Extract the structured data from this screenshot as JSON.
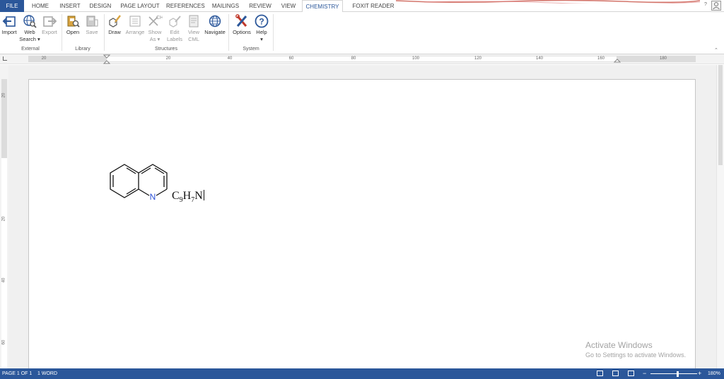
{
  "tabs": [
    {
      "label": "FILE"
    },
    {
      "label": "HOME"
    },
    {
      "label": "INSERT"
    },
    {
      "label": "DESIGN"
    },
    {
      "label": "PAGE LAYOUT"
    },
    {
      "label": "REFERENCES"
    },
    {
      "label": "MAILINGS"
    },
    {
      "label": "REVIEW"
    },
    {
      "label": "VIEW"
    },
    {
      "label": "CHEMISTRY"
    },
    {
      "label": "FOXIT READER PDF"
    }
  ],
  "active_tab": "CHEMISTRY",
  "tabbar_help": "?",
  "ribbon": {
    "import": {
      "label": "Import",
      "icon": "import-icon"
    },
    "web_search": {
      "label": "Web",
      "label2": "Search",
      "icon": "globe-search-icon"
    },
    "export": {
      "label": "Export",
      "icon": "export-icon"
    },
    "group_external": "External",
    "open": {
      "label": "Open",
      "icon": "open-icon"
    },
    "save": {
      "label": "Save",
      "icon": "save-icon"
    },
    "group_library": "Library",
    "draw": {
      "label": "Draw",
      "icon": "draw-icon"
    },
    "arrange": {
      "label": "Arrange",
      "icon": "arrange-icon"
    },
    "show_as": {
      "label": "Show",
      "label2": "As",
      "icon": "show-as-icon"
    },
    "edit_labels": {
      "label": "Edit",
      "label2": "Labels",
      "icon": "edit-labels-icon"
    },
    "view_cml": {
      "label": "View",
      "label2": "CML",
      "icon": "view-cml-icon"
    },
    "navigate": {
      "label": "Navigate",
      "icon": "navigate-icon"
    },
    "group_structures": "Structures",
    "options": {
      "label": "Options",
      "icon": "options-icon"
    },
    "help": {
      "label": "Help",
      "icon": "help-icon"
    },
    "group_system": "System"
  },
  "ruler": {
    "h_ticks": [
      "20",
      "20",
      "40",
      "60",
      "80",
      "100",
      "120",
      "140",
      "160",
      "180"
    ],
    "v_ticks": [
      "20",
      "20",
      "40",
      "60"
    ]
  },
  "document": {
    "structure": "quinoline",
    "atom_label": "N",
    "formula": {
      "c": "C",
      "c_n": "9",
      "h": "H",
      "h_n": "7",
      "n": "N"
    }
  },
  "activate": {
    "title": "Activate Windows",
    "subtitle": "Go to Settings to activate Windows."
  },
  "statusbar": {
    "page": "PAGE 1 OF 1",
    "words": "1 WORD",
    "zoom": "180%"
  },
  "colors": {
    "file_tab": "#2b579a",
    "status_bar": "#2b579a",
    "nitrogen": "#2a4fd6",
    "accent_red": "#c0392b"
  }
}
